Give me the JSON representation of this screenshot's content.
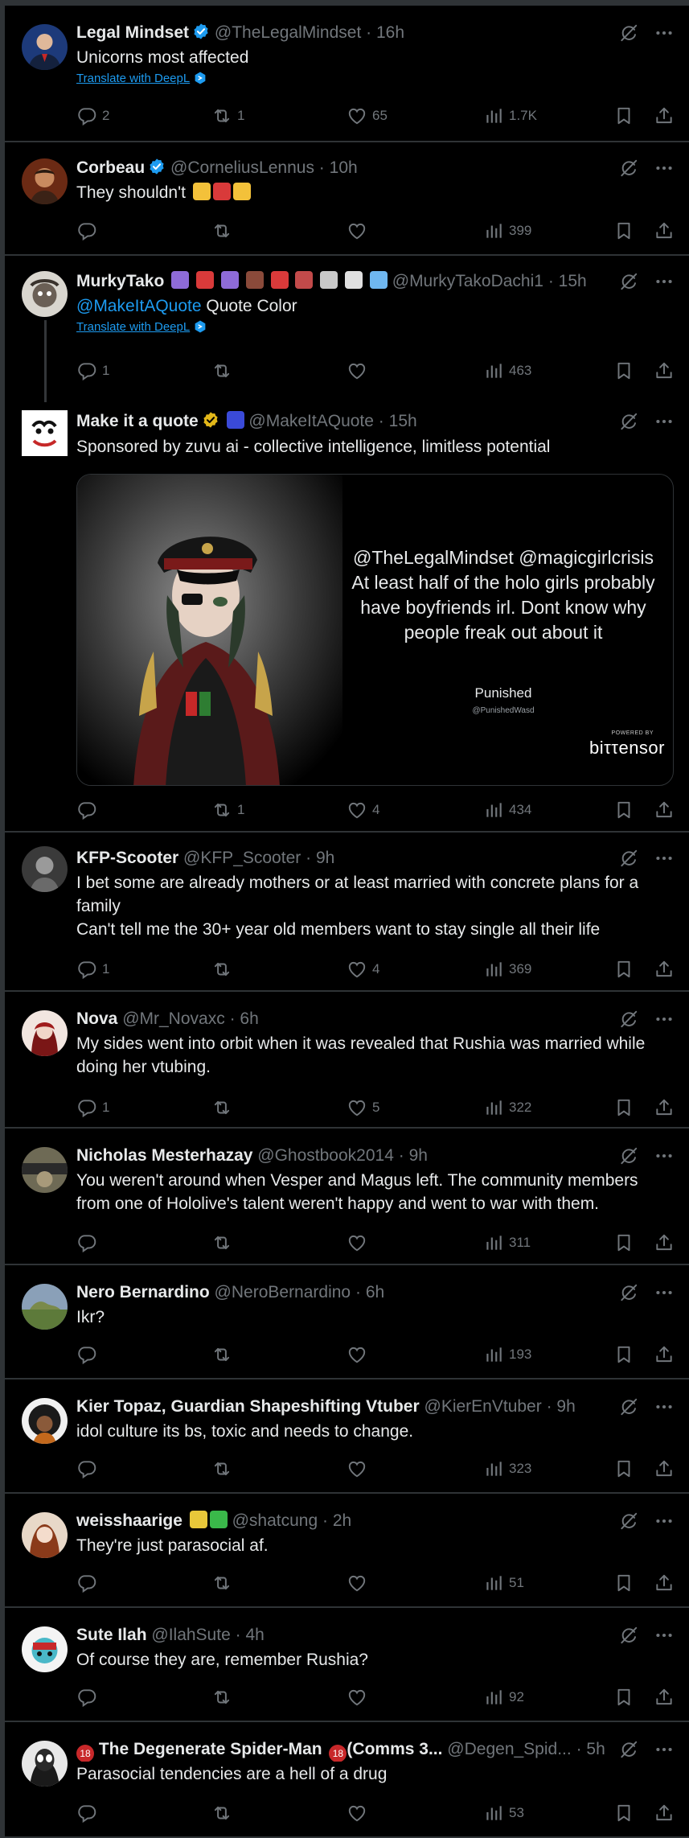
{
  "tweets": [
    {
      "name": "Legal Mindset",
      "handle": "@TheLegalMindset",
      "sep": "·",
      "time": "16h",
      "text": "Unicorns most affected",
      "translate": "Translate with DeepL",
      "replies": "2",
      "reposts": "1",
      "likes": "65",
      "views": "1.7K"
    },
    {
      "name": "Corbeau",
      "handle": "@CorneliusLennus",
      "sep": "·",
      "time": "10h",
      "text": "They shouldn't",
      "replies": "",
      "reposts": "",
      "likes": "",
      "views": "399"
    },
    {
      "name": "MurkyTako",
      "name_decor": "|  |  |  |",
      "handle": "@MurkyTakoDachi1",
      "sep": "·",
      "time": "15h",
      "mention": "@MakeItAQuote",
      "text": " Quote Color",
      "translate": "Translate with DeepL",
      "replies": "1",
      "reposts": "",
      "likes": "",
      "views": "463"
    },
    {
      "name": "Make it a quote",
      "handle": "@MakeItAQuote",
      "sep": "·",
      "time": "15h",
      "text": "Sponsored by zuvu ai - collective intelligence, limitless potential",
      "quote_card": {
        "text": "@TheLegalMindset @magicgirlcrisis At least half of the holo girls probably have boyfriends irl. Dont know why people freak out about it",
        "author": "Punished",
        "author_handle": "@PunishedWasd",
        "powered_by": "POWERED BY",
        "brand": "biττensor"
      },
      "replies": "",
      "reposts": "1",
      "likes": "4",
      "views": "434"
    },
    {
      "name": "KFP-Scooter",
      "handle": "@KFP_Scooter",
      "sep": "·",
      "time": "9h",
      "text": "I bet some are already mothers or at least married with concrete plans for a family",
      "text2": "Can't tell me the 30+ year old members want to stay single all their life",
      "replies": "1",
      "reposts": "",
      "likes": "4",
      "views": "369"
    },
    {
      "name": "Nova",
      "handle": "@Mr_Novaxc",
      "sep": "·",
      "time": "6h",
      "text": "My sides went into orbit when it was revealed that Rushia was married while doing her vtubing.",
      "replies": "1",
      "reposts": "",
      "likes": "5",
      "views": "322"
    },
    {
      "name": "Nicholas Mesterhazay",
      "handle": "@Ghostbook2014",
      "sep": "·",
      "time": "9h",
      "text": "You weren't around when Vesper and Magus left.   The community members from one of Hololive's talent weren't happy and went to war with them.",
      "replies": "",
      "reposts": "",
      "likes": "",
      "views": "311"
    },
    {
      "name": "Nero Bernardino",
      "handle": "@NeroBernardino",
      "sep": "·",
      "time": "6h",
      "text": "Ikr?",
      "replies": "",
      "reposts": "",
      "likes": "",
      "views": "193"
    },
    {
      "name": "Kier Topaz, Guardian Shapeshifting Vtuber",
      "handle": "@KierEnVtuber",
      "sep": "·",
      "time": "9h",
      "text": "idol culture its bs, toxic and needs to change.",
      "replies": "",
      "reposts": "",
      "likes": "",
      "views": "323"
    },
    {
      "name": "weisshaarige",
      "handle": "@shatcung",
      "sep": "·",
      "time": "2h",
      "text": "They're just parasocial af.",
      "replies": "",
      "reposts": "",
      "likes": "",
      "views": "51"
    },
    {
      "name": "Sute Ilah",
      "handle": "@IlahSute",
      "sep": "·",
      "time": "4h",
      "text": "Of course they are, remember Rushia?",
      "replies": "",
      "reposts": "",
      "likes": "",
      "views": "92"
    },
    {
      "name": "The Degenerate Spider-Man",
      "name_suffix": "(Comms 3...",
      "age_mark": "18",
      "handle": "@Degen_Spid...",
      "sep": "·",
      "time": "5h",
      "text": "Parasocial tendencies are a hell of a drug",
      "replies": "",
      "reposts": "",
      "likes": "",
      "views": "53"
    }
  ],
  "colors": {
    "background": "#000000",
    "text": "#e7e9ea",
    "muted": "#71767b",
    "accent": "#1d9bf0",
    "verified_gold": "#e2b719",
    "divider": "#2f3336"
  }
}
